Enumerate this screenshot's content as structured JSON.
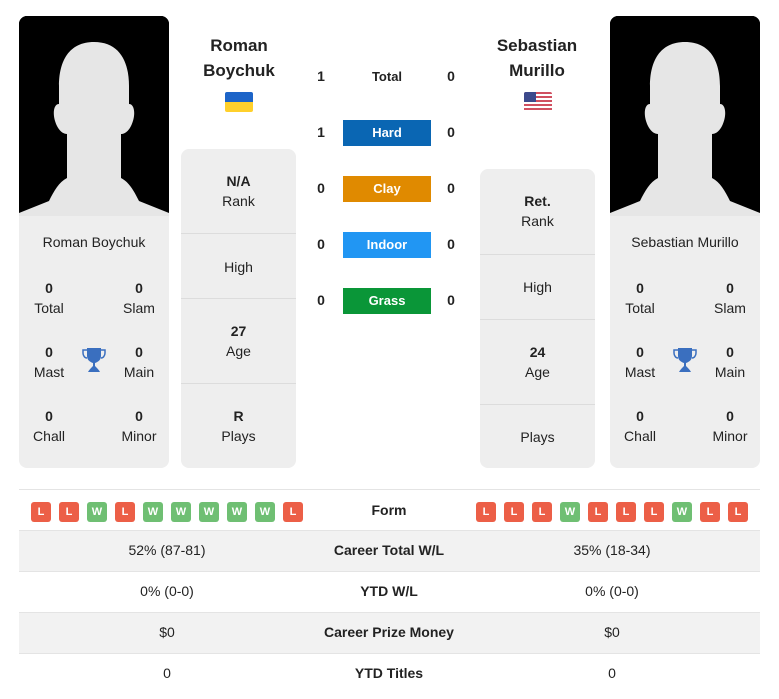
{
  "players": {
    "left": {
      "name": "Roman Boychuk",
      "name_line1": "Roman",
      "name_line2": "Boychuk",
      "country_flag": "ukraine-flag",
      "titles": {
        "total": {
          "value": "0",
          "label": "Total"
        },
        "slam": {
          "value": "0",
          "label": "Slam"
        },
        "mast": {
          "value": "0",
          "label": "Mast"
        },
        "main": {
          "value": "0",
          "label": "Main"
        },
        "chall": {
          "value": "0",
          "label": "Chall"
        },
        "minor": {
          "value": "0",
          "label": "Minor"
        }
      },
      "info": {
        "rank": {
          "value": "N/A",
          "label": "Rank"
        },
        "high": {
          "value": "",
          "label": "High"
        },
        "age": {
          "value": "27",
          "label": "Age"
        },
        "plays": {
          "value": "R",
          "label": "Plays"
        }
      },
      "form": [
        "L",
        "L",
        "W",
        "L",
        "W",
        "W",
        "W",
        "W",
        "W",
        "L"
      ]
    },
    "right": {
      "name": "Sebastian Murillo",
      "name_line1": "Sebastian",
      "name_line2": "Murillo",
      "country_flag": "usa-flag",
      "titles": {
        "total": {
          "value": "0",
          "label": "Total"
        },
        "slam": {
          "value": "0",
          "label": "Slam"
        },
        "mast": {
          "value": "0",
          "label": "Mast"
        },
        "main": {
          "value": "0",
          "label": "Main"
        },
        "chall": {
          "value": "0",
          "label": "Chall"
        },
        "minor": {
          "value": "0",
          "label": "Minor"
        }
      },
      "info": {
        "rank": {
          "value": "Ret.",
          "label": "Rank"
        },
        "high": {
          "value": "",
          "label": "High"
        },
        "age": {
          "value": "24",
          "label": "Age"
        },
        "plays": {
          "value": "",
          "label": "Plays"
        }
      },
      "form": [
        "L",
        "L",
        "L",
        "W",
        "L",
        "L",
        "L",
        "W",
        "L",
        "L"
      ]
    }
  },
  "h2h": [
    {
      "surface": "Total",
      "left": "1",
      "right": "0",
      "color": ""
    },
    {
      "surface": "Hard",
      "left": "1",
      "right": "0",
      "color": "#0a66b3"
    },
    {
      "surface": "Clay",
      "left": "0",
      "right": "0",
      "color": "#e08a00"
    },
    {
      "surface": "Indoor",
      "left": "0",
      "right": "0",
      "color": "#2196f3"
    },
    {
      "surface": "Grass",
      "left": "0",
      "right": "0",
      "color": "#0a9638"
    }
  ],
  "comparison": {
    "form_label": "Form",
    "rows": [
      {
        "label": "Career Total W/L",
        "left": "52% (87-81)",
        "right": "35% (18-34)"
      },
      {
        "label": "YTD W/L",
        "left": "0% (0-0)",
        "right": "0% (0-0)"
      },
      {
        "label": "Career Prize Money",
        "left": "$0",
        "right": "$0"
      },
      {
        "label": "YTD Titles",
        "left": "0",
        "right": "0"
      }
    ]
  },
  "colors": {
    "loss": "#ec5f47",
    "win": "#6fbf73",
    "trophy": "#3a6fbf"
  }
}
